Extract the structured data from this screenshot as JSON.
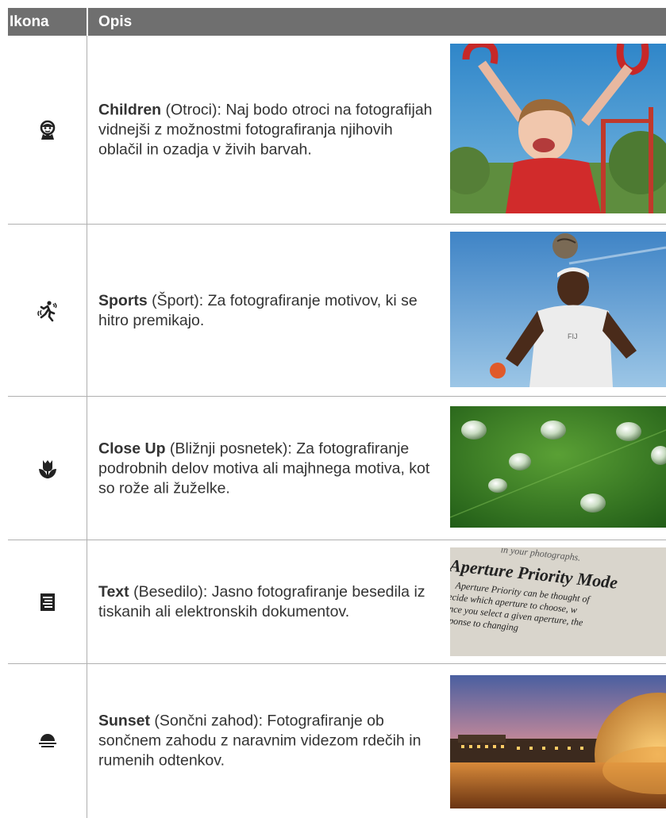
{
  "header": {
    "icon_col": "Ikona",
    "desc_col": "Opis"
  },
  "rows": [
    {
      "icon": "child-face-icon",
      "title": "Children",
      "rest": " (Otroci): Naj bodo otroci na fotografijah vidnejši z možnostmi fotografiranja njihovih oblačil in ozadja v živih barvah.",
      "photo": "photo of a smiling girl hanging on red gymnastic rings outdoors"
    },
    {
      "icon": "running-person-icon",
      "title": "Sports",
      "rest": " (Šport): Za fotografiranje motivov, ki se hitro premikajo.",
      "photo": "photo of a soccer player heading a ball against the sky"
    },
    {
      "icon": "tulip-flower-icon",
      "title": "Close Up",
      "rest": " (Bližnji posnetek): Za fotografiranje podrobnih delov motiva ali majhnega motiva, kot so rože ali žuželke.",
      "photo": "photo of water droplets on a green leaf"
    },
    {
      "icon": "document-text-icon",
      "title": "Text",
      "rest": " (Besedilo): Jasno fotografiranje besedila iz tiskanih ali elektronskih dokumentov.",
      "photo": "photo of a printed page with text"
    },
    {
      "icon": "sunset-icon",
      "title": "Sunset",
      "rest": " (Sončni zahod): Fotografiranje ob sončnem zahodu z naravnim videzom rdečih in rumenih odtenkov.",
      "photo": "photo of a dome building reflected in water at dusk"
    }
  ],
  "text_photo": {
    "top": "in your photographs.",
    "heading": "Aperture Priority Mode",
    "l1": "Aperture Priority can be thought of",
    "l2": "decide which aperture to choose, w",
    "l3": "Once you select a given aperture, the",
    "l4": "response to changing"
  }
}
